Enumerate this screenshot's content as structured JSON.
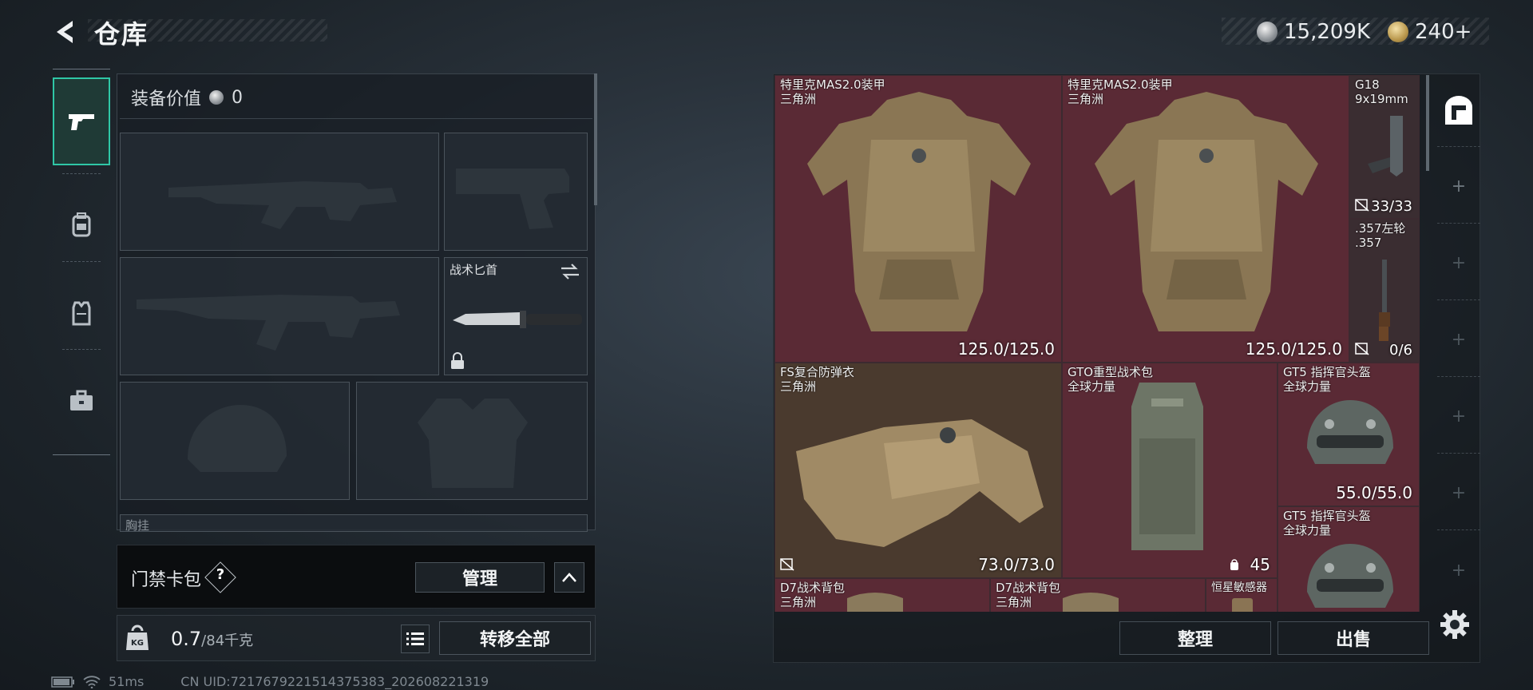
{
  "header": {
    "title": "仓库"
  },
  "currency": {
    "silver": "15,209K",
    "gold": "240+"
  },
  "leftnav": {
    "items": [
      "weapons",
      "backpack",
      "vest",
      "case"
    ]
  },
  "equipment": {
    "value_label": "装备价值",
    "value": "0",
    "knife_label": "战术匕首",
    "chest_label": "胸挂",
    "card_label": "门禁卡包",
    "help": "?",
    "manage_label": "管理"
  },
  "weight": {
    "current": "0.7",
    "max_unit": "/84千克",
    "kg_icon_text": "KG",
    "transfer_label": "转移全部"
  },
  "status": {
    "ping": "51ms",
    "uid": "CN UID:7217679221514375383_202608221319"
  },
  "inventory": {
    "items": [
      {
        "name": "特里克MAS2.0装甲",
        "sub": "三角洲",
        "value": "125.0/125.0"
      },
      {
        "name": "特里克MAS2.0装甲",
        "sub": "三角洲",
        "value": "125.0/125.0"
      },
      {
        "name": "G18",
        "sub": "9x19mm",
        "value": "33/33"
      },
      {
        "name": ".357左轮",
        "sub": ".357",
        "value": "0/6"
      },
      {
        "name": "FS复合防弹衣",
        "sub": "三角洲",
        "value": "73.0/73.0"
      },
      {
        "name": "GTO重型战术包",
        "sub": "全球力量",
        "value": "45"
      },
      {
        "name": "GT5 指挥官头盔",
        "sub": "全球力量",
        "value": "55.0/55.0"
      },
      {
        "name": "GT5 指挥官头盔",
        "sub": "全球力量",
        "value": ""
      },
      {
        "name": "D7战术背包",
        "sub": "三角洲",
        "value": ""
      },
      {
        "name": "D7战术背包",
        "sub": "三角洲",
        "value": ""
      },
      {
        "name": "恒星敏感器",
        "sub": "",
        "value": ""
      }
    ],
    "sort_label": "整理",
    "sell_label": "出售",
    "add": "+"
  },
  "colors": {
    "accent": "#2fc7a6",
    "rare_red": "#5a2a35",
    "rare_brown": "#4a3a2e"
  }
}
